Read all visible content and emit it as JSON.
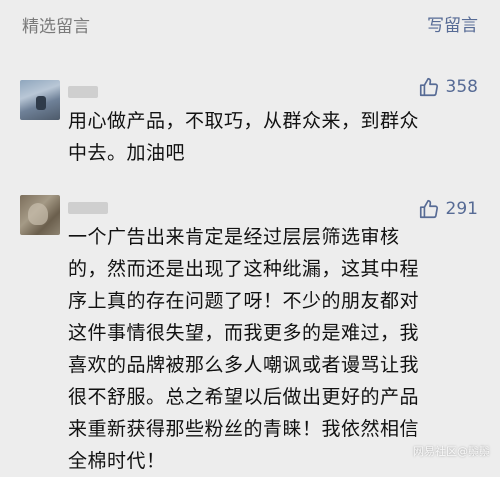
{
  "header": {
    "title": "精选留言",
    "write_label": "写留言"
  },
  "comments": [
    {
      "likes": "358",
      "lines": [
        "用心做产品，不取巧，从群众来，到群众",
        "中去。加油吧"
      ]
    },
    {
      "likes": "291",
      "lines": [
        "一个广告出来肯定是经过层层筛选审核",
        "的，然而还是出现了这种纰漏，这其中程",
        "序上真的存在问题了呀！不少的朋友都对",
        "这件事情很失望，而我更多的是难过，我",
        "喜欢的品牌被那么多人嘲讽或者谩骂让我",
        "很不舒服。总之希望以后做出更好的产品",
        "来重新获得那些粉丝的青睐！我依然相信",
        "全棉时代！"
      ]
    }
  ],
  "watermark": "网易社区@鬃鬃",
  "icons": {
    "like": "thumbs-up-icon",
    "avatar": "avatar-image"
  },
  "colors": {
    "link": "#576b95",
    "muted": "#7a7a7a",
    "background": "#ededed"
  }
}
